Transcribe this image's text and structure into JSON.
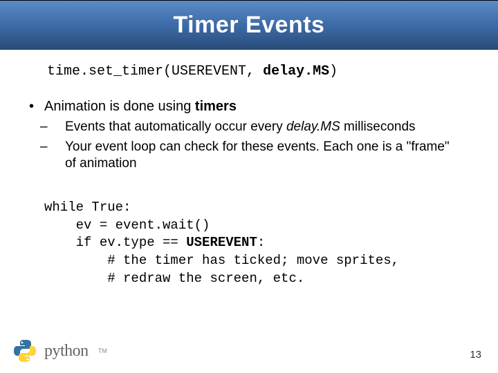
{
  "title": "Timer Events",
  "signature": {
    "prefix": "time.set_timer(USEREVENT, ",
    "arg": "delay.MS",
    "suffix": ")"
  },
  "bullet": {
    "pre": "Animation is done using ",
    "bold": "timers"
  },
  "sub1": {
    "pre": "Events that automatically occur every ",
    "italic": "delay.MS",
    "post": "  milliseconds"
  },
  "sub2": "Your event loop can check for these events.  Each one is a \"frame\" of animation",
  "code": {
    "l1": "while True:",
    "l2": "    ev = event.wait()",
    "l3a": "    if ev.type == ",
    "l3b": "USEREVENT",
    "l3c": ":",
    "l4": "        # the timer has ticked; move sprites,",
    "l5": "        # redraw the screen, etc."
  },
  "logo_text": "python",
  "logo_tm": "TM",
  "page_number": "13"
}
